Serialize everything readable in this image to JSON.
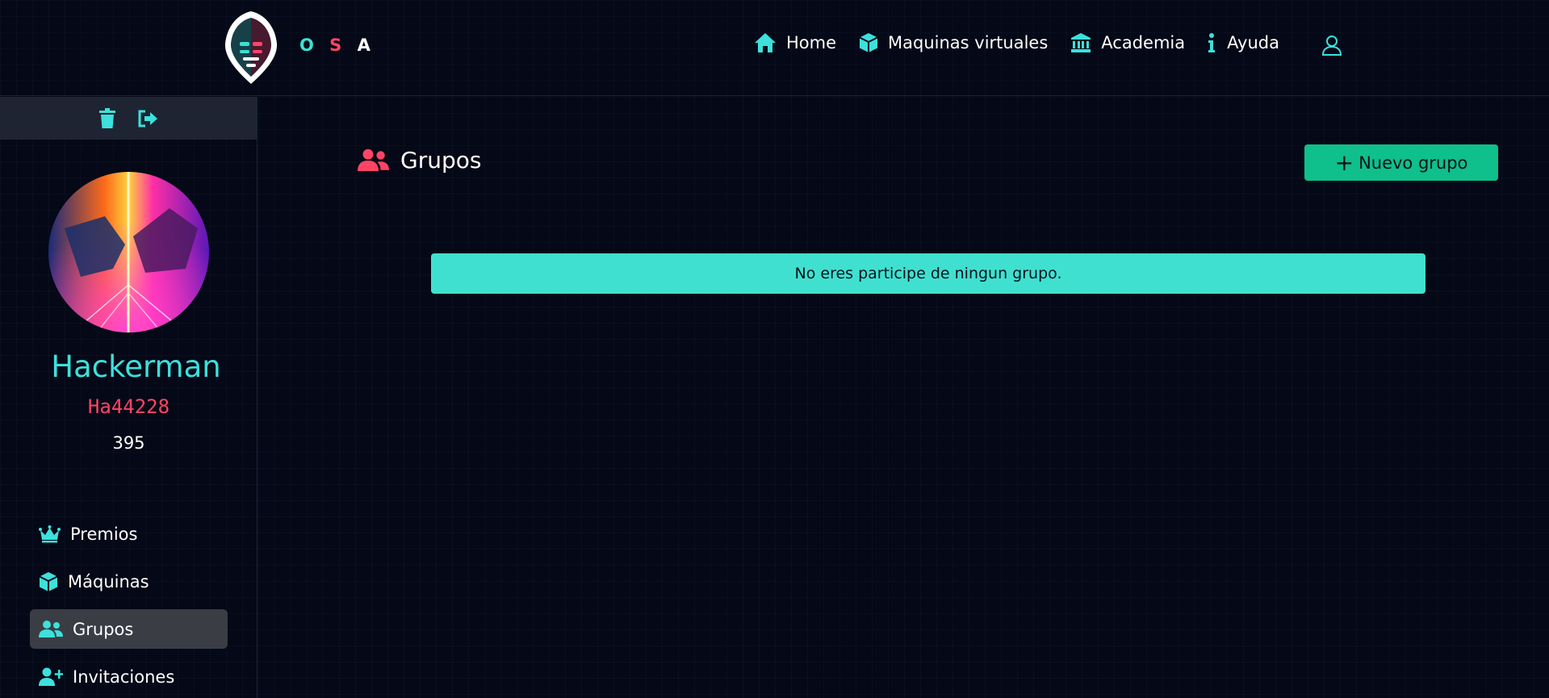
{
  "brand": {
    "letters": [
      "O",
      "S",
      "A"
    ]
  },
  "nav": {
    "home": "Home",
    "machines": "Maquinas virtuales",
    "academy": "Academia",
    "help": "Ayuda"
  },
  "profile": {
    "name": "Hackerman",
    "id": "Ha44228",
    "score": "395"
  },
  "sidebar_menu": [
    {
      "label": "Premios",
      "icon": "crown-icon"
    },
    {
      "label": "Máquinas",
      "icon": "cube-icon"
    },
    {
      "label": "Grupos",
      "icon": "users-icon",
      "active": true
    },
    {
      "label": "Invitaciones",
      "icon": "user-plus-icon"
    }
  ],
  "main": {
    "title": "Grupos",
    "new_group_button": "Nuevo grupo",
    "empty_message": "No eres participe de ningun grupo."
  },
  "colors": {
    "accent_cyan": "#3de0dc",
    "accent_red": "#ff4466",
    "button_green": "#0fbf8c",
    "alert_bg": "#40e0d0",
    "background": "#050816"
  }
}
